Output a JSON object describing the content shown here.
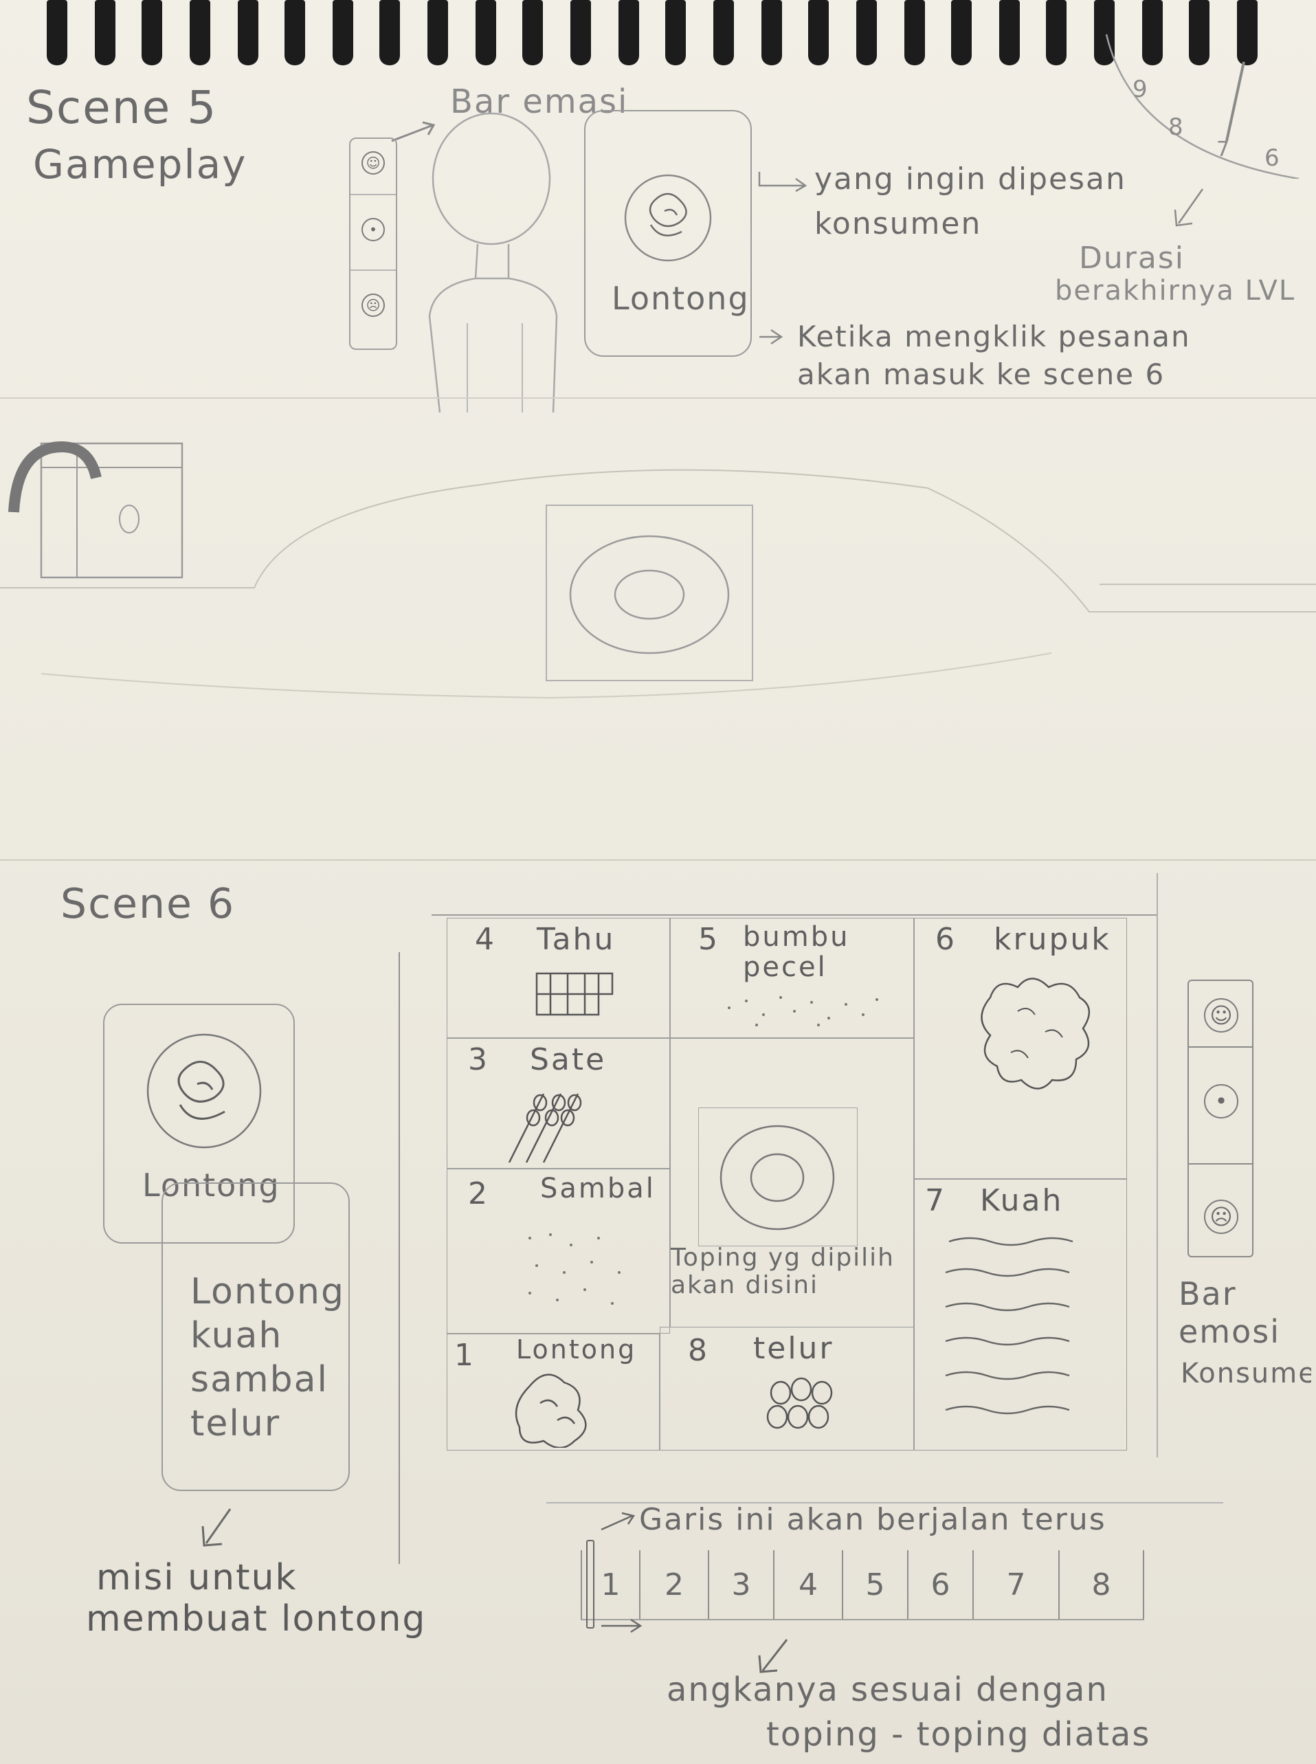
{
  "scene5": {
    "title": "Scene 5",
    "subtitle": "Gameplay",
    "emotion_bar_label": "Bar emasi",
    "order_note_1": "yang ingin dipesan",
    "order_note_2": "konsumen",
    "order_item": "Lontong",
    "click_note_1": "Ketika mengklik pesanan",
    "click_note_2": "akan masuk ke scene 6",
    "timer_label_1": "Durasi",
    "timer_label_2": "berakhirnya LVL",
    "timer_numbers": [
      "9",
      "8",
      "7",
      "6"
    ]
  },
  "scene6": {
    "title": "Scene 6",
    "order_item": "Lontong",
    "recipe_lines": [
      "Lontong",
      "kuah",
      "sambal",
      "telur"
    ],
    "mission_1": "misi untuk",
    "mission_2": "membuat lontong",
    "toppings": {
      "t1_num": "1",
      "t1_name": "Lontong",
      "t2_num": "2",
      "t2_name": "Sambal",
      "t3_num": "3",
      "t3_name": "Sate",
      "t4_num": "4",
      "t4_name": "Tahu",
      "t5_num": "5",
      "t5_name": "bumbu pecel",
      "t6_num": "6",
      "t6_name": "krupuk",
      "t7_num": "7",
      "t7_name": "Kuah",
      "t8_num": "8",
      "t8_name": "telur"
    },
    "plate_note_1": "Toping yg dipilih",
    "plate_note_2": "akan disini",
    "emotion_label_1": "Bar",
    "emotion_label_2": "emosi",
    "emotion_label_3": "Konsumen",
    "timeline_note": "Garis ini akan berjalan terus",
    "timeline_numbers": [
      "1",
      "2",
      "3",
      "4",
      "5",
      "6",
      "7",
      "8"
    ],
    "bottom_note_1": "angkanya sesuai dengan",
    "bottom_note_2": "toping - toping diatas"
  }
}
